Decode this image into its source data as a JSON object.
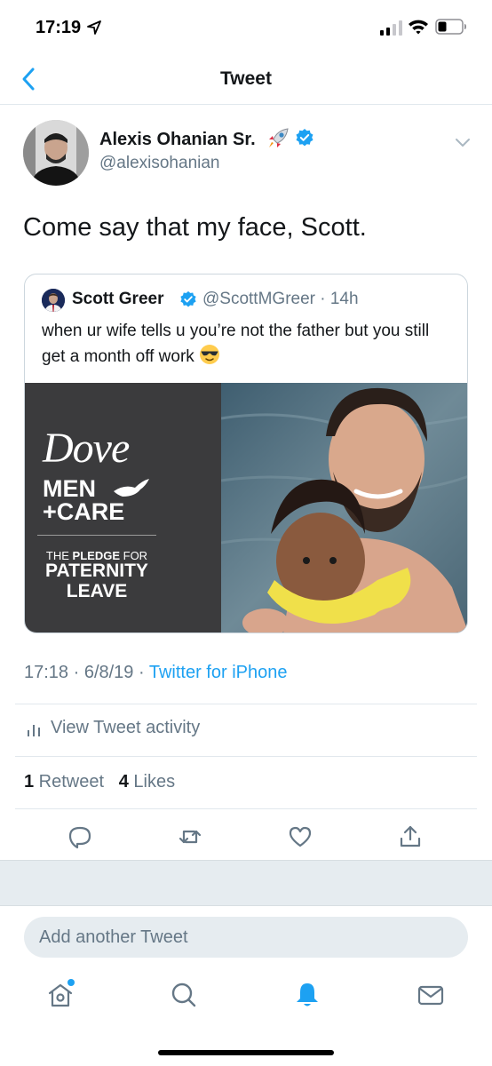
{
  "status_bar": {
    "time": "17:19"
  },
  "header": {
    "title": "Tweet",
    "icons": {
      "back": "back-chevron-icon"
    }
  },
  "tweet": {
    "author_name": "Alexis Ohanian Sr.",
    "author_handle": "@alexisohanian",
    "text": "Come say that my face, Scott.",
    "timestamp": "17:18 · 6/8/19 · ",
    "source": "Twitter for iPhone"
  },
  "quoted_tweet": {
    "author_name": "Scott Greer",
    "meta": "@ScottMGreer · 14h",
    "text": "when ur wife tells u you’re not the father but you still get a month off work",
    "media": {
      "brand_word": "Dove",
      "men_word": "MEN",
      "care_word": "+CARE",
      "pledge_prefix": "THE ",
      "pledge_bold": "PLEDGE",
      "pledge_suffix": " FOR",
      "line_paternity": "PATERNITY",
      "line_leave": "LEAVE"
    }
  },
  "activity": {
    "label": "View Tweet activity"
  },
  "counts": {
    "retweets": "1",
    "retweets_label": " Retweet",
    "likes": "4",
    "likes_label": " Likes"
  },
  "actions": [
    {
      "name": "reply",
      "icon": "reply-icon"
    },
    {
      "name": "retweet",
      "icon": "retweet-icon"
    },
    {
      "name": "like",
      "icon": "heart-icon"
    },
    {
      "name": "share",
      "icon": "share-icon"
    }
  ],
  "composer": {
    "placeholder": "Add another Tweet"
  },
  "tabbar": [
    {
      "name": "home",
      "icon": "home-icon"
    },
    {
      "name": "search",
      "icon": "search-icon"
    },
    {
      "name": "notifications",
      "icon": "bell-icon",
      "active": true
    },
    {
      "name": "messages",
      "icon": "mail-icon"
    }
  ],
  "colors": {
    "accent": "#1da1f2",
    "secondary_text": "#657786",
    "primary_text": "#14171a",
    "divider": "#e1e8ed"
  }
}
